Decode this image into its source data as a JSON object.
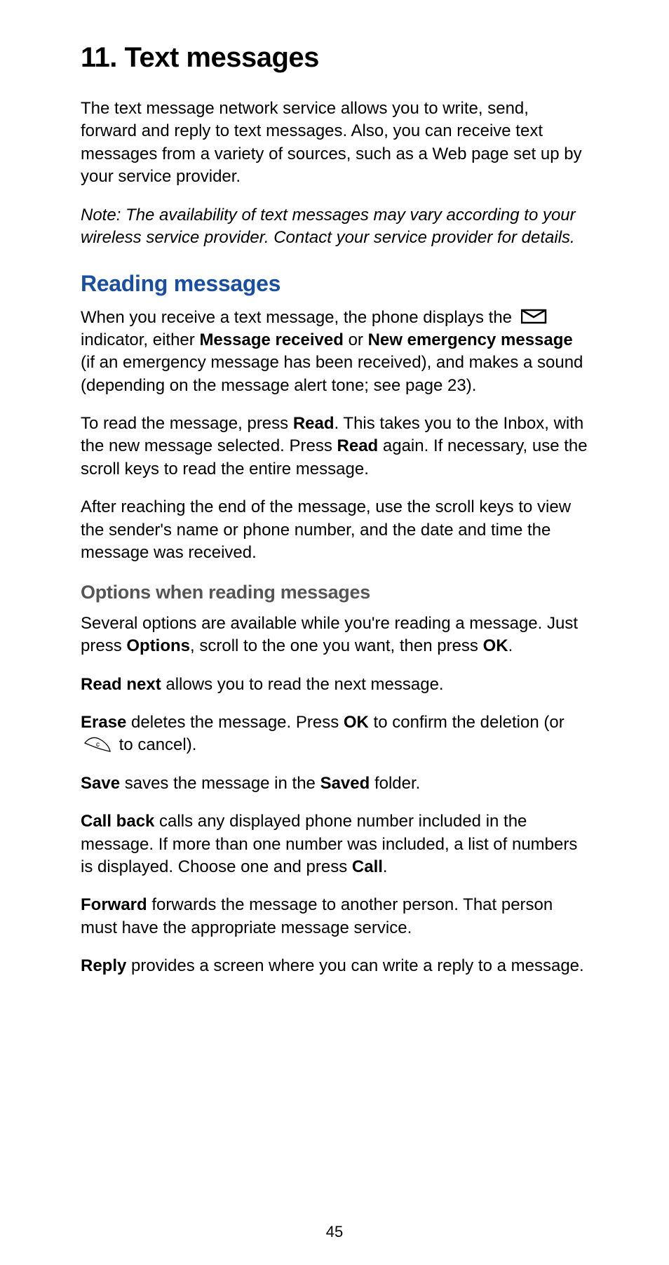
{
  "chapter": {
    "number": "11.",
    "title": "Text messages"
  },
  "intro": "The text message network service allows you to write, send, forward and reply to text messages. Also, you can receive text messages from a variety of sources, such as a Web page set up by your service provider.",
  "note": "Note:  The availability of text messages may vary according to your wireless service provider. Contact your service provider for details.",
  "section_reading": {
    "heading": "Reading messages",
    "p1_a": "When you receive a text message, the phone displays the ",
    "p1_b": " indicator, either ",
    "p1_bold1": "Message received",
    "p1_c": " or ",
    "p1_bold2": "New emergency message",
    "p1_d": " (if an emergency message has been received), and makes a sound (depending on the message alert tone; see page 23).",
    "p2_a": "To read the message, press ",
    "p2_bold1": "Read",
    "p2_b": ". This takes you to the Inbox, with the new message selected. Press ",
    "p2_bold2": "Read",
    "p2_c": " again. If necessary, use the scroll keys to read the entire message.",
    "p3": "After reaching the end of the message, use the scroll keys to view the sender's name or phone number, and the date and time the message was received."
  },
  "section_options": {
    "heading": "Options when reading messages",
    "p1_a": "Several options are available while you're reading a message. Just press ",
    "p1_bold1": "Options",
    "p1_b": ", scroll to the one you want, then press ",
    "p1_bold2": "OK",
    "p1_c": ".",
    "readnext_bold": "Read next",
    "readnext_text": " allows you to read the next message.",
    "erase_bold": "Erase",
    "erase_a": " deletes the message. Press ",
    "erase_ok": "OK",
    "erase_b": " to confirm the deletion (or ",
    "erase_c": " to cancel).",
    "save_bold": "Save",
    "save_a": " saves the message in the ",
    "save_saved": "Saved",
    "save_b": " folder.",
    "callback_bold": "Call back",
    "callback_a": " calls any displayed phone number included in the message. If more than one number was included, a list of numbers is displayed. Choose one and press ",
    "callback_call": "Call",
    "callback_b": ".",
    "forward_bold": "Forward",
    "forward_text": " forwards the message to another person. That person must have the appropriate message service.",
    "reply_bold": "Reply",
    "reply_text": " provides a screen where you can write a reply to a message."
  },
  "page_number": "45"
}
